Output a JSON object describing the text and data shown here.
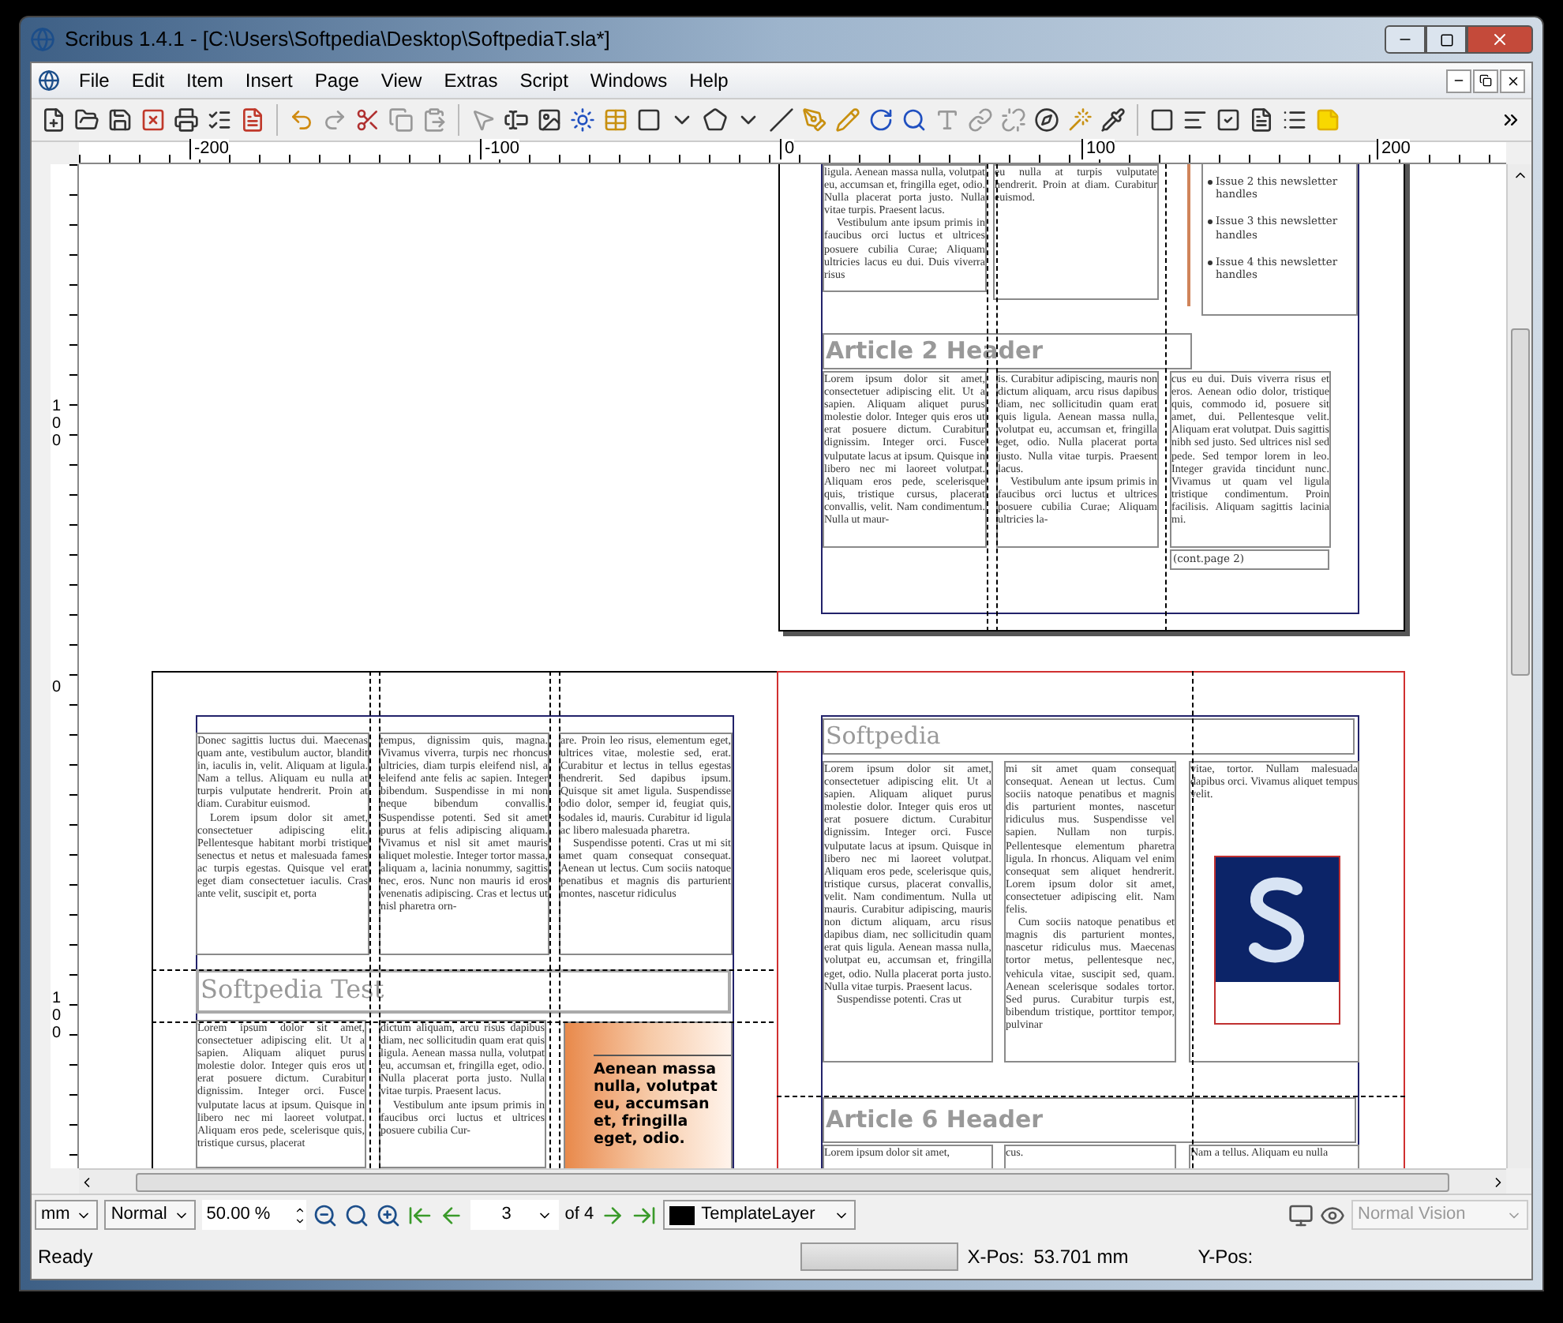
{
  "window": {
    "title": "Scribus 1.4.1 - [C:\\Users\\Softpedia\\Desktop\\SoftpediaT.sla*]"
  },
  "menu": [
    "File",
    "Edit",
    "Item",
    "Insert",
    "Page",
    "View",
    "Extras",
    "Script",
    "Windows",
    "Help"
  ],
  "ruler": {
    "horizontal": [
      "-200",
      "-100",
      "0",
      "100",
      "200"
    ],
    "vertical": [
      "100",
      "0",
      "100"
    ]
  },
  "top_page": {
    "column_frames": [
      {
        "paragraphs": [
          "ligula. Aenean massa nulla, volutpat eu, accumsan et, fringilla eget, odio. Nulla placerat porta justo. Nulla vitae turpis. Praesent lacus.",
          "Vestibulum ante ipsum primis in faucibus orci luctus et ultrices posuere cubilia Curae; Aliquam ultricies lacus eu dui. Duis viverra risus"
        ]
      },
      {
        "paragraphs": [
          "eu nulla at turpis vulputate hendrerit. Proin at diam. Curabitur euismod."
        ]
      }
    ],
    "sidebar_list": [
      "Issue 2 this newsletter handles",
      "Issue 3 this newsletter handles",
      "Issue 4 this newsletter handles"
    ],
    "header": "Article 2 Header",
    "article_columns": [
      {
        "paragraphs": [
          "Lorem ipsum dolor sit amet, consectetuer adipiscing elit. Ut a sapien. Aliquam aliquet purus molestie dolor. Integer quis eros ut erat posuere dictum. Curabitur dignissim. Integer orci. Fusce vulputate lacus at ipsum. Quisque in libero nec mi laoreet volutpat. Aliquam eros pede, scelerisque quis, tristique cursus, placerat convallis, velit. Nam condimentum. Nulla ut maur-"
        ]
      },
      {
        "paragraphs": [
          "is. Curabitur adipiscing, mauris non dictum aliquam, arcu risus dapibus diam, nec sollicitudin quam erat quis ligula. Aenean massa nulla, volutpat eu, accumsan et, fringilla eget, odio. Nulla placerat porta justo. Nulla vitae turpis. Praesent lacus.",
          "Vestibulum ante ipsum primis in faucibus orci luctus et ultrices posuere cubilia Curae; Aliquam ultricies la-"
        ]
      },
      {
        "paragraphs": [
          "cus eu dui. Duis viverra risus et eros. Aenean odio dolor, tristique quis, commodo id, posuere sit amet, dui. Pellentesque velit. Aliquam erat volutpat. Duis sagittis nibh sed justo. Sed ultrices nisl sed pede. Sed tempor lorem in leo. Integer gravida tincidunt nunc. Vivamus ut quam vel ligula tristique condimentum. Proin facilisis. Aliquam sagittis lacinia mi."
        ]
      }
    ],
    "continuation": "(cont.page 2)"
  },
  "left_page": {
    "top_columns": [
      {
        "paragraphs": [
          "Donec sagittis luctus dui. Maecenas quam ante, vestibulum auctor, blandit in, iaculis in, velit. Aliquam at ligula. Nam a tellus. Aliquam eu nulla at turpis vulputate hendrerit. Proin at diam. Curabitur euismod.",
          "Lorem ipsum dolor sit amet, consectetuer adipiscing elit. Pellentesque habitant morbi tristique senectus et netus et malesuada fames ac turpis egestas. Quisque vel erat eget diam consectetuer iaculis. Cras ante velit, suscipit et, porta"
        ]
      },
      {
        "paragraphs": [
          "tempus, dignissim quis, magna. Vivamus viverra, turpis nec rhoncus ultricies, diam turpis eleifend nisl, a eleifend ante felis ac sapien. Integer bibendum. Suspendisse in mi non neque bibendum convallis. Suspendisse potenti. Sed sit amet purus at felis adipiscing aliquam. Vivamus et nisl sit amet mauris aliquet molestie. Integer tortor massa, aliquam a, lacinia nonummy, sagittis nec, eros. Nunc non mauris id eros venenatis adipiscing. Cras et lectus ut nisl pharetra orn-"
        ]
      },
      {
        "paragraphs": [
          "are. Proin leo risus, elementum eget, ultrices vitae, molestie sed, erat. Curabitur et lectus in tellus egestas hendrerit. Sed dapibus ipsum. Quisque sit amet ligula. Suspendisse odio dolor, semper id, feugiat quis, sodales id, mauris. Curabitur id ligula ac libero malesuada pharetra.",
          "Suspendisse potenti. Cras ut mi sit amet quam consequat consequat. Aenean ut lectus. Cum sociis natoque penatibus et magnis dis parturient montes, nascetur ridiculus"
        ]
      }
    ],
    "title": "Softpedia Test",
    "bottom_columns": [
      {
        "paragraphs": [
          "Lorem ipsum dolor sit amet, consectetuer adipiscing elit. Ut a sapien. Aliquam aliquet purus molestie dolor. Integer quis eros ut erat posuere dictum. Curabitur dignissim. Integer orci. Fusce vulputate lacus at ipsum. Quisque in libero nec mi laoreet volutpat. Aliquam eros pede, scelerisque quis, tristique cursus, placerat"
        ]
      },
      {
        "paragraphs": [
          "dictum aliquam, arcu risus dapibus diam, nec sollicitudin quam erat quis ligula. Aenean massa nulla, volutpat eu, accumsan et, fringilla eget, odio. Nulla placerat porta justo. Nulla vitae turpis. Praesent lacus.",
          "Vestibulum ante ipsum primis in faucibus orci luctus et ultrices posuere cubilia Cur-"
        ]
      }
    ],
    "pull_quote": "Aenean massa nulla, volutpat eu, accumsan et, fringilla eget, odio."
  },
  "right_page": {
    "title": "Softpedia",
    "columns": [
      {
        "paragraphs": [
          "Lorem ipsum dolor sit amet, consectetuer adipiscing elit. Ut a sapien. Aliquam aliquet purus molestie dolor. Integer quis eros ut erat posuere dictum. Curabitur dignissim. Integer orci. Fusce vulputate lacus at ipsum. Quisque in libero nec mi laoreet volutpat. Aliquam eros pede, scelerisque quis, tristique cursus, placerat convallis, velit. Nam condimentum. Nulla ut mauris. Curabitur adipiscing, mauris non dictum aliquam, arcu risus dapibus diam, nec sollicitudin quam erat quis ligula. Aenean massa nulla, volutpat eu, accumsan et, fringilla eget, odio. Nulla placerat porta justo. Nulla vitae turpis. Praesent lacus.",
          "Suspendisse potenti. Cras ut"
        ]
      },
      {
        "paragraphs": [
          "mi sit amet quam consequat consequat. Aenean ut lectus. Cum sociis natoque penatibus et magnis dis parturient montes, nascetur ridiculus mus. Suspendisse vel sapien. Nullam non turpis. Pellentesque elementum pharetra ligula. In rhoncus. Aliquam vel enim consequat sem aliquet hendrerit. Lorem ipsum dolor sit amet, consectetuer adipiscing elit. Nam felis.",
          "Cum sociis natoque penatibus et magnis dis parturient montes, nascetur ridiculus mus. Maecenas tortor metus, pellentesque nec, vehicula vitae, suscipit sed, quam. Aenean scelerisque sodales tortor. Sed purus. Curabitur turpis est, bibendum tristique, porttitor tempor, pulvinar"
        ]
      },
      {
        "paragraphs": [
          "vitae, tortor. Nullam malesuada dapibus orci. Vivamus aliquet tempus velit."
        ]
      }
    ],
    "header": "Article 6 Header",
    "header_columns": [
      {
        "paragraphs": [
          "Lorem ipsum dolor sit amet,"
        ]
      },
      {
        "paragraphs": [
          "cus."
        ]
      },
      {
        "paragraphs": [
          "Nam a tellus. Aliquam eu nulla"
        ]
      }
    ]
  },
  "bottom_bar": {
    "unit": "mm",
    "mode": "Normal",
    "zoom": "50.00 %",
    "page": "3",
    "page_count": "of 4",
    "layer": "TemplateLayer",
    "vision": "Normal Vision"
  },
  "status_bar": {
    "message": "Ready",
    "x_label": "X-Pos:",
    "x_value": "53.701 mm",
    "y_label": "Y-Pos:"
  }
}
